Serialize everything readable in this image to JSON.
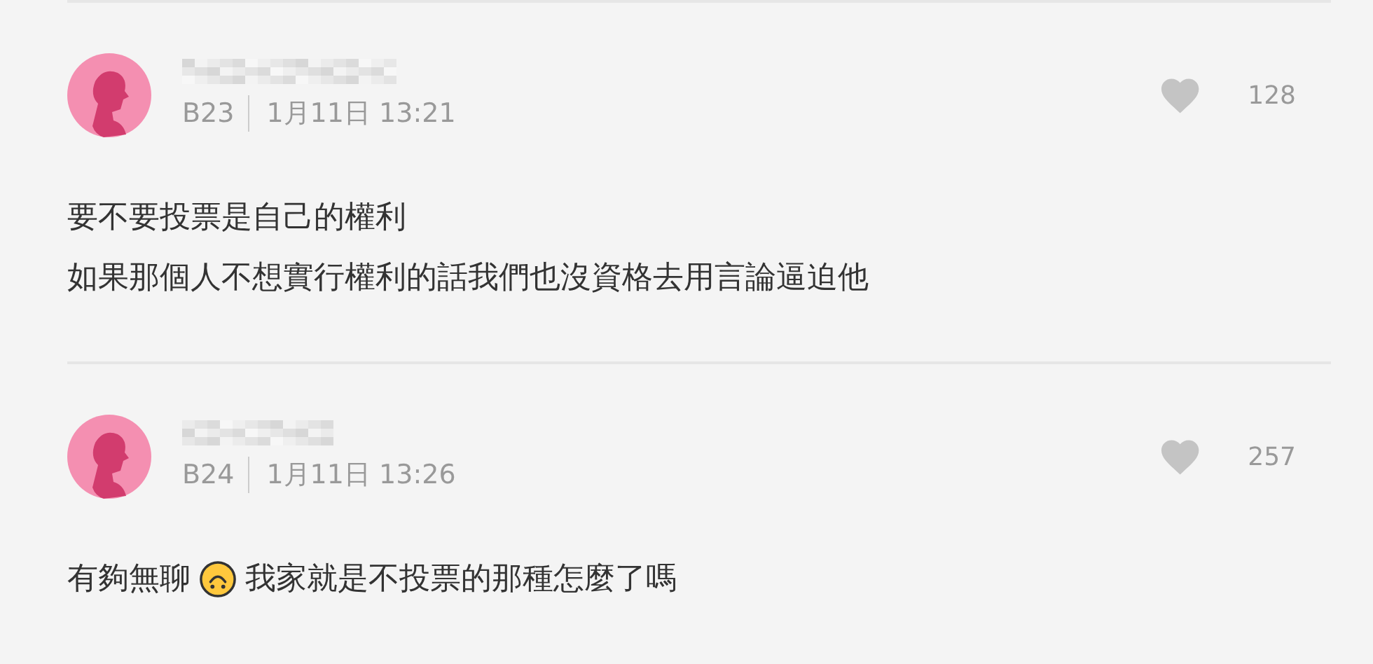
{
  "comments": [
    {
      "floor": "B23",
      "time": "1月11日 13:21",
      "likes": "128",
      "liked": false,
      "lines": [
        [
          {
            "kind": "text",
            "text": "要不要投票是自己的權利"
          }
        ],
        [
          {
            "kind": "text",
            "text": "如果那個人不想實行權利的話我們也沒資格去用言論逼迫他"
          }
        ]
      ]
    },
    {
      "floor": "B24",
      "time": "1月11日 13:26",
      "likes": "257",
      "liked": false,
      "lines": [
        [
          {
            "kind": "text",
            "text": "有夠無聊"
          },
          {
            "kind": "emoji"
          },
          {
            "kind": "text",
            "text": "我家就是不投票的那種怎麼了嗎"
          }
        ]
      ]
    }
  ]
}
